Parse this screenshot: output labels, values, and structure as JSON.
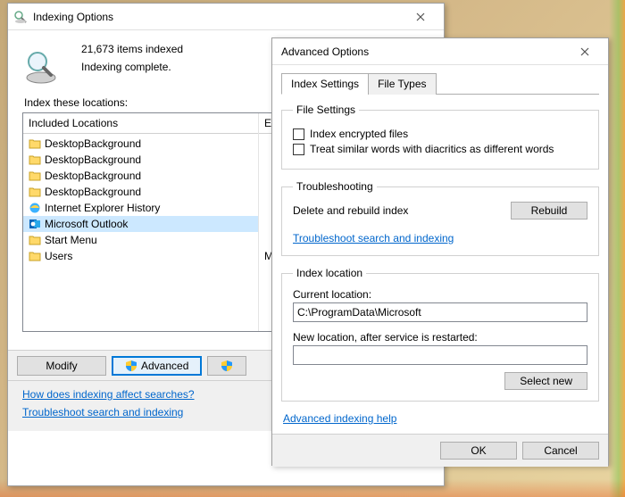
{
  "index_window": {
    "title": "Indexing Options",
    "items_indexed": "21,673 items indexed",
    "status": "Indexing complete.",
    "locations_label": "Index these locations:",
    "col_included": "Included Locations",
    "col_excluded": "Exclude",
    "locations": [
      {
        "name": "DesktopBackground",
        "icon": "folder"
      },
      {
        "name": "DesktopBackground",
        "icon": "folder"
      },
      {
        "name": "DesktopBackground",
        "icon": "folder"
      },
      {
        "name": "DesktopBackground",
        "icon": "folder"
      },
      {
        "name": "Internet Explorer History",
        "icon": "ie"
      },
      {
        "name": "Microsoft Outlook",
        "icon": "outlook",
        "selected": true
      },
      {
        "name": "Start Menu",
        "icon": "folder"
      },
      {
        "name": "Users",
        "icon": "folder",
        "exclude": "Microsoft"
      }
    ],
    "buttons": {
      "modify": "Modify",
      "advanced": "Advanced",
      "third": ""
    },
    "links": {
      "how": "How does indexing affect searches?",
      "troubleshoot": "Troubleshoot search and indexing"
    }
  },
  "adv_window": {
    "title": "Advanced Options",
    "tabs": {
      "settings": "Index Settings",
      "filetypes": "File Types"
    },
    "file_settings": {
      "legend": "File Settings",
      "encrypted": "Index encrypted files",
      "diacritics": "Treat similar words with diacritics as different words"
    },
    "troubleshooting": {
      "legend": "Troubleshooting",
      "rebuild_label": "Delete and rebuild index",
      "rebuild_btn": "Rebuild",
      "link": "Troubleshoot search and indexing"
    },
    "index_location": {
      "legend": "Index location",
      "current_label": "Current location:",
      "current_value": "C:\\ProgramData\\Microsoft",
      "new_label": "New location, after service is restarted:",
      "new_value": "",
      "select_btn": "Select new"
    },
    "help_link": "Advanced indexing help",
    "ok": "OK",
    "cancel": "Cancel"
  }
}
